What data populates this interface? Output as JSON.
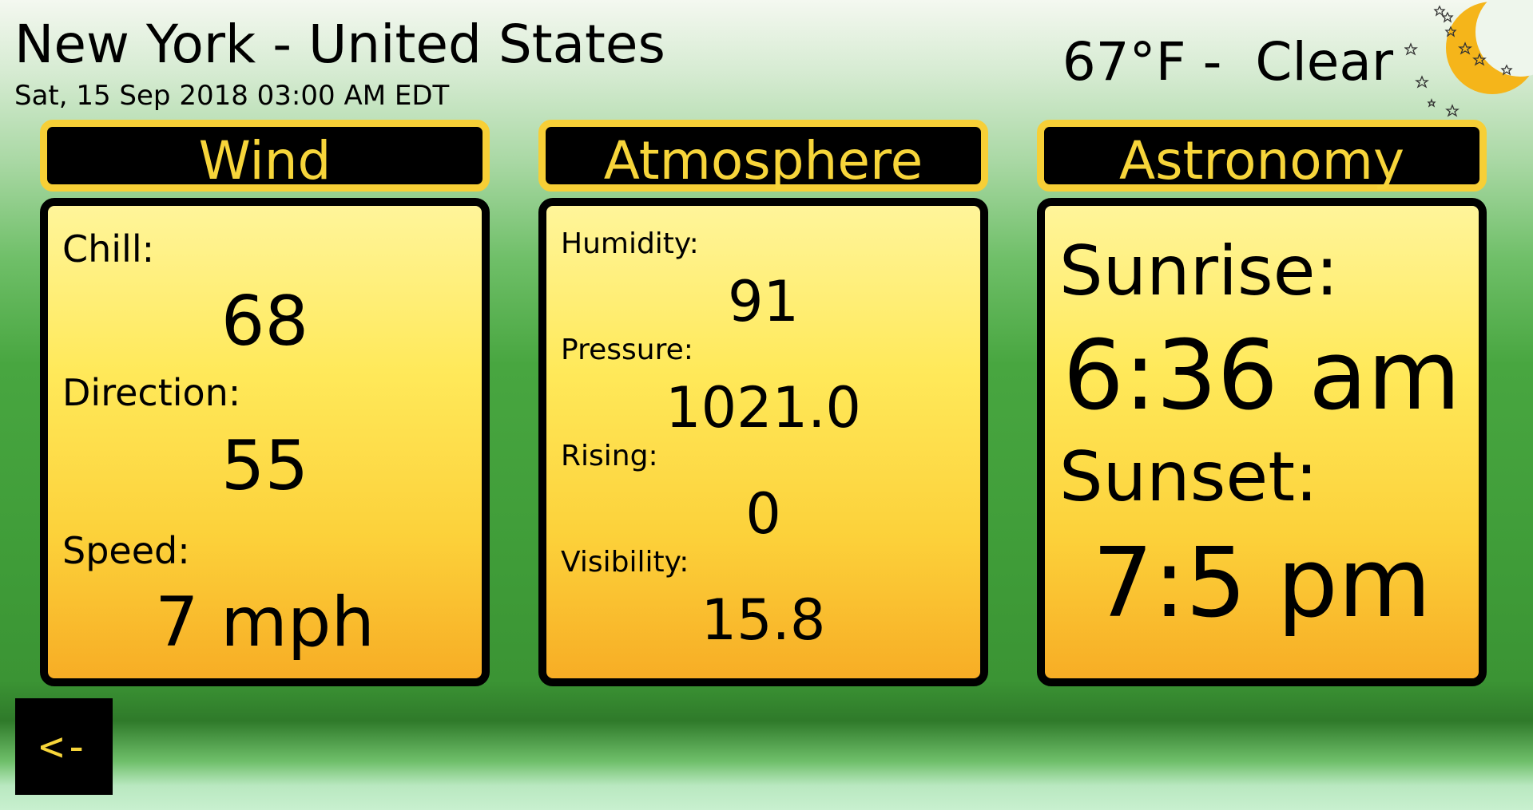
{
  "header": {
    "location": "New York - United States",
    "datetime": "Sat, 15 Sep 2018 03:00 AM EDT",
    "condition": "67°F -  Clear",
    "condition_icon": "crescent-moon-stars-icon"
  },
  "panels": {
    "wind": {
      "title": "Wind",
      "chill_label": "Chill:",
      "chill_value": "68",
      "direction_label": "Direction:",
      "direction_value": "55",
      "speed_label": "Speed:",
      "speed_value": "7 mph"
    },
    "atmosphere": {
      "title": "Atmosphere",
      "humidity_label": "Humidity:",
      "humidity_value": "91",
      "pressure_label": "Pressure:",
      "pressure_value": "1021.0",
      "rising_label": "Rising:",
      "rising_value": "0",
      "visibility_label": "Visibility:",
      "visibility_value": "15.8"
    },
    "astronomy": {
      "title": "Astronomy",
      "sunrise_label": "Sunrise:",
      "sunrise_value": "6:36 am",
      "sunset_label": "Sunset:",
      "sunset_value": "7:5 pm"
    }
  },
  "nav": {
    "back_label": "<-"
  },
  "colors": {
    "accent": "#f7d53a",
    "panel_border": "#000000",
    "header_border": "#f7cf36"
  }
}
